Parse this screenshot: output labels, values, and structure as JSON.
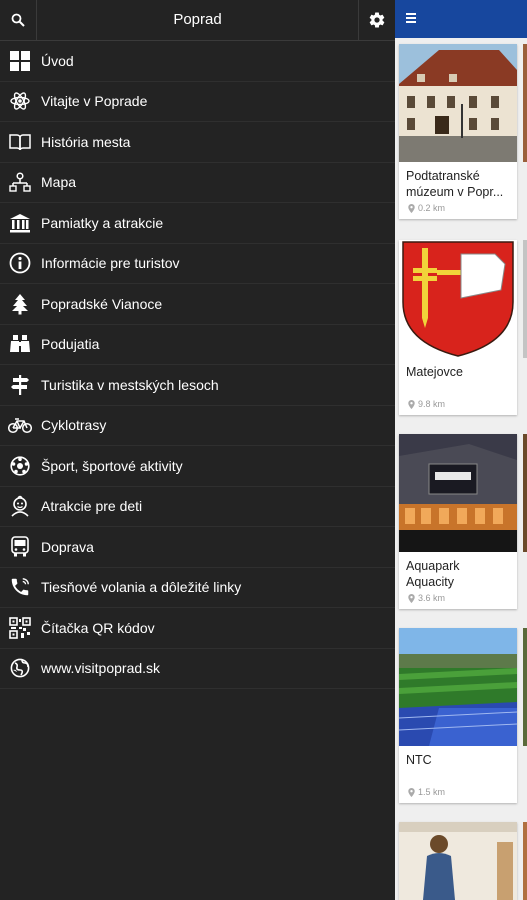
{
  "drawer": {
    "title": "Poprad",
    "items": [
      {
        "label": "Úvod",
        "icon": "grid-icon"
      },
      {
        "label": "Vitajte v Poprade",
        "icon": "atom-icon"
      },
      {
        "label": "História mesta",
        "icon": "book-icon"
      },
      {
        "label": "Mapa",
        "icon": "map-network-icon"
      },
      {
        "label": "Pamiatky a atrakcie",
        "icon": "museum-icon"
      },
      {
        "label": "Informácie pre turistov",
        "icon": "info-icon"
      },
      {
        "label": "Popradské Vianoce",
        "icon": "tree-icon"
      },
      {
        "label": "Podujatia",
        "icon": "binoculars-icon"
      },
      {
        "label": "Turistika v mestských lesoch",
        "icon": "signpost-icon"
      },
      {
        "label": "Cyklotrasy",
        "icon": "bicycle-icon"
      },
      {
        "label": "Šport, športové aktivity",
        "icon": "ball-icon"
      },
      {
        "label": "Atrakcie pre deti",
        "icon": "child-icon"
      },
      {
        "label": "Doprava",
        "icon": "bus-icon"
      },
      {
        "label": "Tiesňové volania a dôležité linky",
        "icon": "phone-icon"
      },
      {
        "label": "Čítačka QR kódov",
        "icon": "qr-code-icon"
      },
      {
        "label": "www.visitpoprad.sk",
        "icon": "globe-icon"
      }
    ]
  },
  "colors": {
    "topbar": "#17479e",
    "drawer_bg": "#232323"
  },
  "cards": [
    {
      "name": "Podtatranské múzeum v Popr...",
      "distance": "0.2 km"
    },
    {
      "name": "Matejovce",
      "distance": "9.8 km"
    },
    {
      "name": "Aquapark Aquacity",
      "distance": "3.6 km"
    },
    {
      "name": "NTC",
      "distance": "1.5 km"
    }
  ]
}
